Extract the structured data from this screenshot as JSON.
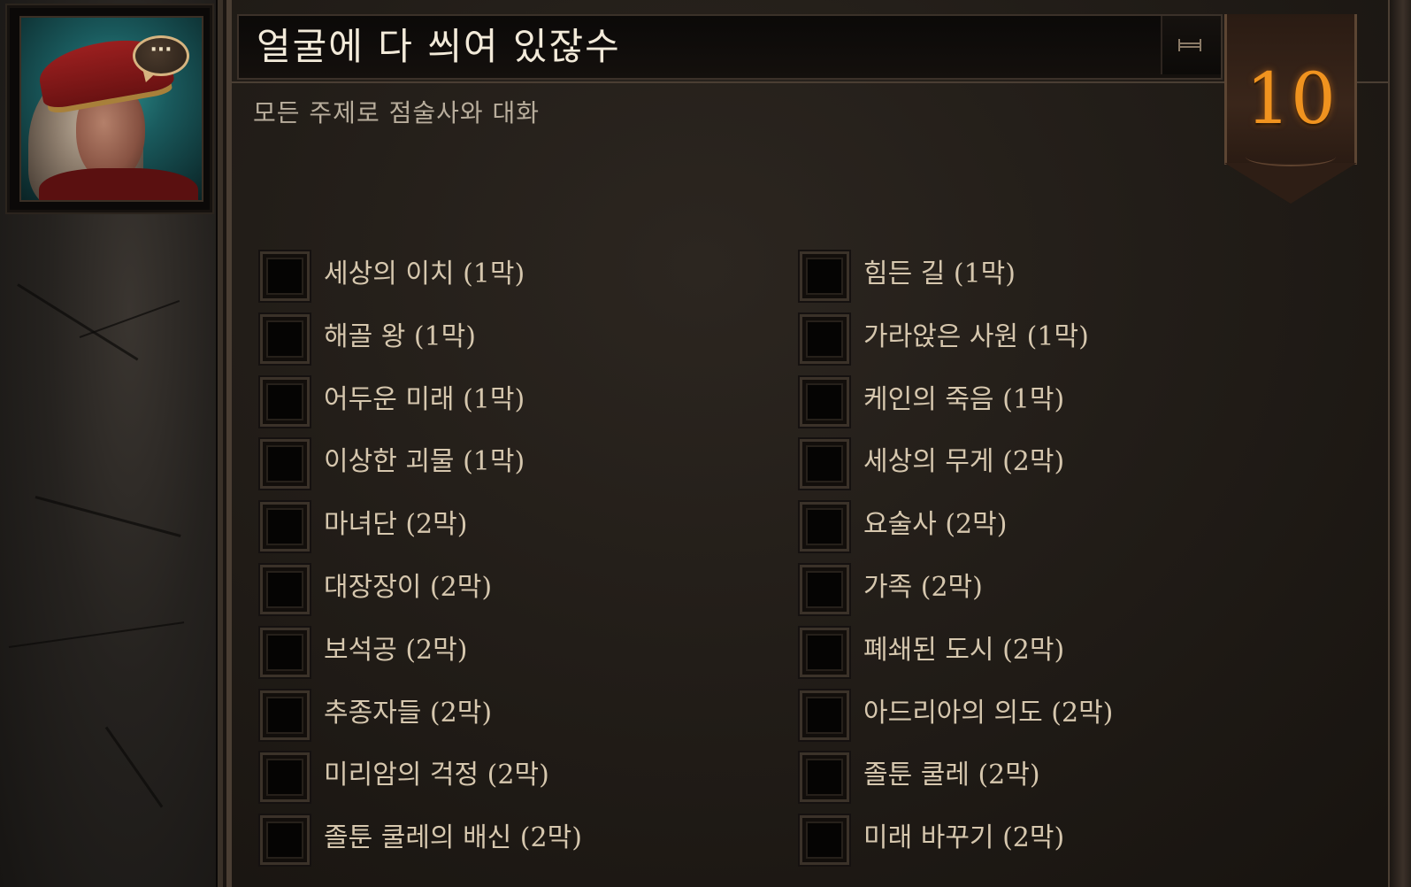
{
  "quest": {
    "title": "얼굴에 다 씌여 있잖수",
    "subtitle": "모든 주제로 점술사와 대화",
    "count": "10",
    "speech_bubble": "···"
  },
  "portrait": {
    "icon": "fortune-teller-portrait",
    "colors": {
      "background": "#2d8f8c",
      "scarf": "#9b1f1f"
    }
  },
  "colors": {
    "accent": "#f0931f",
    "text": "#d6c7ae",
    "title_text": "#f2ead9",
    "subtitle_text": "#b8ad9c"
  },
  "checklist": {
    "left": [
      {
        "label": "세상의 이치 (1막)",
        "checked": false
      },
      {
        "label": "해골 왕 (1막)",
        "checked": false
      },
      {
        "label": "어두운 미래 (1막)",
        "checked": false
      },
      {
        "label": "이상한 괴물 (1막)",
        "checked": false
      },
      {
        "label": "마녀단 (2막)",
        "checked": false
      },
      {
        "label": "대장장이 (2막)",
        "checked": false
      },
      {
        "label": "보석공 (2막)",
        "checked": false
      },
      {
        "label": "추종자들 (2막)",
        "checked": false
      },
      {
        "label": "미리암의 걱정 (2막)",
        "checked": false
      },
      {
        "label": "졸툰 쿨레의 배신 (2막)",
        "checked": false
      }
    ],
    "right": [
      {
        "label": "힘든 길 (1막)",
        "checked": false
      },
      {
        "label": "가라앉은 사원 (1막)",
        "checked": false
      },
      {
        "label": "케인의 죽음 (1막)",
        "checked": false
      },
      {
        "label": "세상의 무게 (2막)",
        "checked": false
      },
      {
        "label": "요술사 (2막)",
        "checked": false
      },
      {
        "label": "가족 (2막)",
        "checked": false
      },
      {
        "label": "폐쇄된 도시 (2막)",
        "checked": false
      },
      {
        "label": "아드리아의 의도 (2막)",
        "checked": false
      },
      {
        "label": "졸툰 쿨레 (2막)",
        "checked": false
      },
      {
        "label": "미래 바꾸기 (2막)",
        "checked": false
      }
    ]
  }
}
